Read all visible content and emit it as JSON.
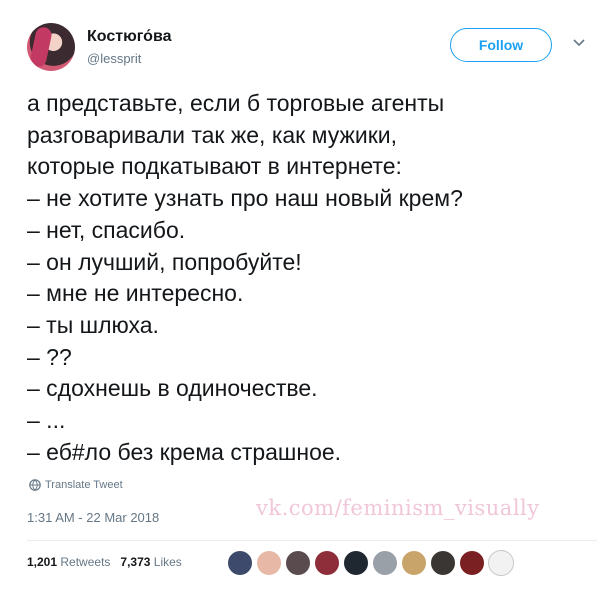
{
  "header": {
    "name": "Костюго́ва",
    "handle": "@lessprit",
    "follow_label": "Follow"
  },
  "tweet": {
    "lines": [
      "а представьте, если б торговые агенты",
      "разговаривали так же, как мужики,",
      "которые подкатывают в интернете:",
      "– не хотите узнать про наш новый крем?",
      "– нет, спасибо.",
      "– он лучший, попробуйте!",
      "– мне не интересно.",
      "– ты шлюха.",
      "– ??",
      "– сдохнешь в одиночестве.",
      "– ...",
      "– еб#ло без крема страшное."
    ]
  },
  "translate_label": "Translate Tweet",
  "timestamp": "1:31 AM - 22 Mar 2018",
  "watermark": "vk.com/feminism_visually",
  "stats": {
    "retweets_count": "1,201",
    "retweets_label": "Retweets",
    "likes_count": "7,373",
    "likes_label": "Likes"
  },
  "likers": [
    {
      "icon": "avatar-icon",
      "color": "#3d4a6b"
    },
    {
      "icon": "avatar-icon",
      "color": "#e8b8a6"
    },
    {
      "icon": "avatar-icon",
      "color": "#5a4b4f"
    },
    {
      "icon": "avatar-icon",
      "color": "#8e2e3a"
    },
    {
      "icon": "avatar-icon",
      "color": "#1f2730"
    },
    {
      "icon": "avatar-icon",
      "color": "#9aa0a8"
    },
    {
      "icon": "avatar-icon",
      "color": "#c9a46a"
    },
    {
      "icon": "avatar-icon",
      "color": "#3a3633"
    },
    {
      "icon": "avatar-icon",
      "color": "#7a1f22"
    },
    {
      "icon": "avatar-icon",
      "color": "#f2f2f2"
    }
  ],
  "colors": {
    "accent": "#1da1f2",
    "text": "#14171a",
    "secondary": "#657786"
  }
}
